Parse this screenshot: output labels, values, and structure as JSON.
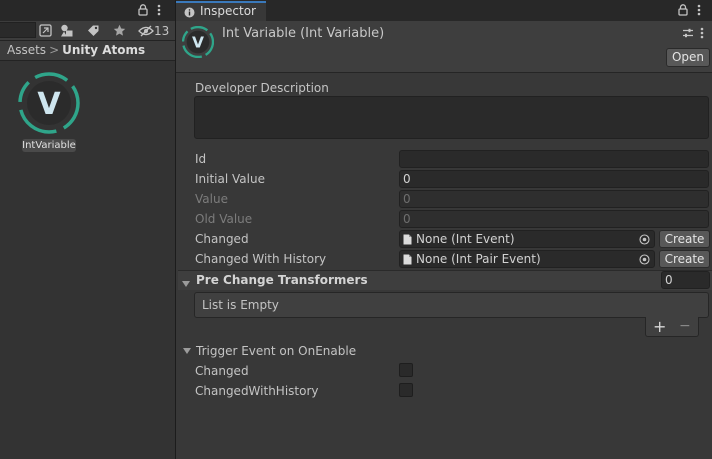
{
  "project": {
    "hidden_count": "13",
    "breadcrumb": {
      "root": "Assets",
      "separator": ">",
      "current": "Unity Atoms"
    },
    "assets": [
      {
        "label": "IntVariable",
        "icon": "v-atom-icon",
        "glyph": "V"
      }
    ]
  },
  "inspector": {
    "tab_label": "Inspector",
    "asset_glyph": "V",
    "title": "Int Variable (Int Variable)",
    "open_button": "Open",
    "developer_description": {
      "label": "Developer Description",
      "value": ""
    },
    "fields": {
      "id": {
        "label": "Id",
        "value": ""
      },
      "initial_value": {
        "label": "Initial Value",
        "value": "0"
      },
      "value": {
        "label": "Value",
        "value": "0"
      },
      "old_value": {
        "label": "Old Value",
        "value": "0"
      },
      "changed": {
        "label": "Changed",
        "value": "None (Int Event)",
        "button": "Create"
      },
      "changed_with_history": {
        "label": "Changed With History",
        "value": "None (Int Pair Event)",
        "button": "Create"
      }
    },
    "pre_change_transformers": {
      "label": "Pre Change Transformers",
      "count": "0",
      "empty_text": "List is Empty",
      "add": "+",
      "remove": "−"
    },
    "trigger_event": {
      "label": "Trigger Event on OnEnable",
      "changed_label": "Changed",
      "changed_with_history_label": "ChangedWithHistory",
      "changed_checked": false,
      "changed_with_history_checked": false
    }
  },
  "colors": {
    "accent_teal": "#2fa58a",
    "tab_highlight": "#3a79bb"
  }
}
